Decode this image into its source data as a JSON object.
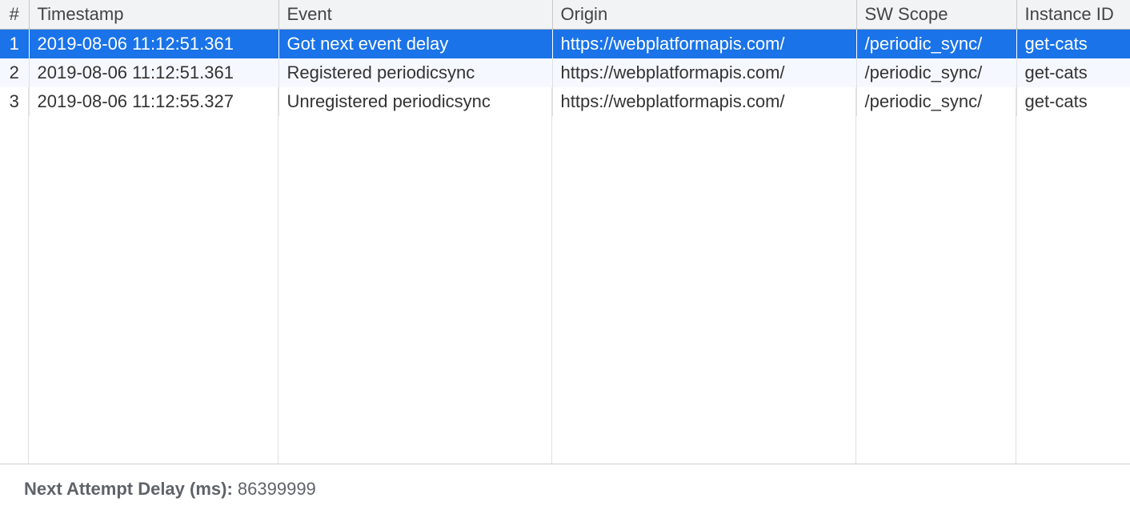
{
  "columns": {
    "num": "#",
    "timestamp": "Timestamp",
    "event": "Event",
    "origin": "Origin",
    "scope": "SW Scope",
    "instance": "Instance ID"
  },
  "rows": [
    {
      "num": "1",
      "timestamp": "2019-08-06 11:12:51.361",
      "event": "Got next event delay",
      "origin": "https://webplatformapis.com/",
      "scope": "/periodic_sync/",
      "instance": "get-cats",
      "selected": true
    },
    {
      "num": "2",
      "timestamp": "2019-08-06 11:12:51.361",
      "event": "Registered periodicsync",
      "origin": "https://webplatformapis.com/",
      "scope": "/periodic_sync/",
      "instance": "get-cats",
      "striped": true
    },
    {
      "num": "3",
      "timestamp": "2019-08-06 11:12:55.327",
      "event": "Unregistered periodicsync",
      "origin": "https://webplatformapis.com/",
      "scope": "/periodic_sync/",
      "instance": "get-cats"
    }
  ],
  "footer": {
    "label": "Next Attempt Delay (ms): ",
    "value": "86399999"
  }
}
